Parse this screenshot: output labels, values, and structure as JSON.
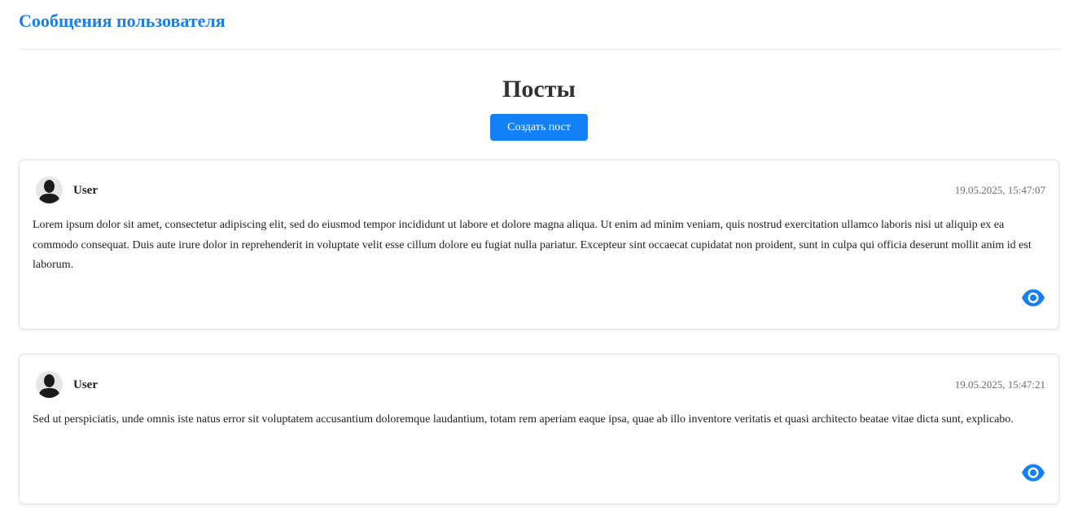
{
  "header": {
    "title": "Сообщения пользователя"
  },
  "main": {
    "heading": "Посты",
    "create_button_label": "Создать пост"
  },
  "posts": [
    {
      "author": "User",
      "timestamp": "19.05.2025, 15:47:07",
      "text": "Lorem ipsum dolor sit amet, consectetur adipiscing elit, sed do eiusmod tempor incididunt ut labore et dolore magna aliqua. Ut enim ad minim veniam, quis nostrud exercitation ullamco laboris nisi ut aliquip ex ea commodo consequat. Duis aute irure dolor in reprehenderit in voluptate velit esse cillum dolore eu fugiat nulla pariatur. Excepteur sint occaecat cupidatat non proident, sunt in culpa qui officia deserunt mollit anim id est laborum.",
      "avatar_icon": "user-silhouette-icon",
      "action_icon": "eye-icon"
    },
    {
      "author": "User",
      "timestamp": "19.05.2025, 15:47:21",
      "text": "Sed ut perspiciatis, unde omnis iste natus error sit voluptatem accusantium doloremque laudantium, totam rem aperiam eaque ipsa, quae ab illo inventore veritatis et quasi architecto beatae vitae dicta sunt, explicabo.",
      "avatar_icon": "user-silhouette-icon",
      "action_icon": "eye-icon"
    }
  ],
  "colors": {
    "accent": "#1381f5",
    "header_title": "#1a7fe8",
    "timestamp": "#6c6c6c"
  }
}
